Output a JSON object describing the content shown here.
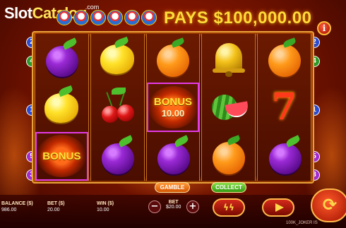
{
  "header": {
    "logo_slot": "Slot",
    "logo_catalog": "Catalog",
    "logo_com": ".com",
    "jackpot": "PAYS $100,000.00",
    "info_label": "i"
  },
  "grid": [
    [
      "plum",
      "lemon",
      "bonus"
    ],
    [
      "lemon",
      "cherry",
      "plum"
    ],
    [
      "orange",
      "bonus",
      "plum"
    ],
    [
      "bell",
      "watermelon",
      "orange"
    ],
    [
      "orange",
      "seven",
      "plum"
    ]
  ],
  "bonus_texts": {
    "word": "BONUS",
    "reel3_value": "10.00"
  },
  "paylines_left": [
    {
      "label": "2",
      "color": "#2a4ad1"
    },
    {
      "label": "4",
      "color": "#2a9a2a"
    },
    {
      "label": "1",
      "color": "#2a4ad1"
    },
    {
      "label": "5",
      "color": "#a02ad1"
    },
    {
      "label": "3",
      "color": "#a02ad1"
    }
  ],
  "paylines_right": [
    {
      "label": "2",
      "color": "#2a4ad1"
    },
    {
      "label": "4",
      "color": "#2a9a2a"
    },
    {
      "label": "1",
      "color": "#2a4ad1"
    },
    {
      "label": "5",
      "color": "#a02ad1"
    },
    {
      "label": "3",
      "color": "#a02ad1"
    }
  ],
  "buttons": {
    "gamble": "GAMBLE",
    "collect": "COLLECT",
    "minus": "−",
    "plus": "+",
    "turbo": "ϟϟ",
    "spin": "⟳"
  },
  "stats": {
    "balance_label": "BALANCE ($)",
    "balance_value": "986.00",
    "bet_label": "BET ($)",
    "bet_value": "20.00",
    "win_label": "WIN ($)",
    "win_value": "10.00",
    "bet_center_label": "BET",
    "bet_center_value": "$20.00"
  },
  "footer": "100K_JOKER    IS",
  "colors": {
    "accent": "#ffdb3a",
    "win_outline": "#e23be8"
  }
}
